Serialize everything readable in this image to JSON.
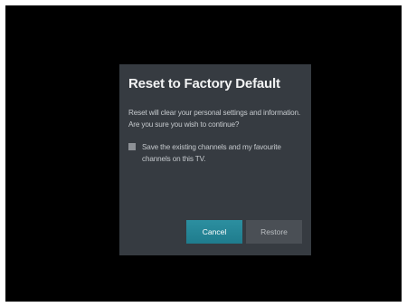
{
  "dialog": {
    "title": "Reset to Factory Default",
    "message_lines": [
      "Reset will clear your personal settings and information.",
      "Are you sure you wish to continue?"
    ],
    "checkbox": {
      "label_lines": [
        "Save the existing channels and my favourite",
        "channels on this TV."
      ],
      "checked": false
    },
    "buttons": {
      "cancel_label": "Cancel",
      "restore_label": "Restore"
    }
  },
  "colors": {
    "screen_background": "#000000",
    "dialog_background": "#363b41",
    "primary_button": "#2c8fa0",
    "secondary_button": "#4a4f55"
  }
}
